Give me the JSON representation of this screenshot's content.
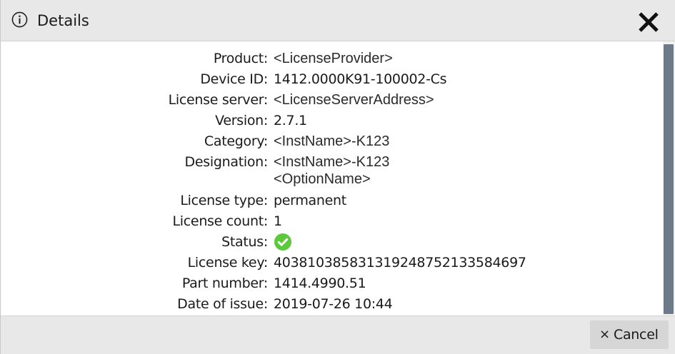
{
  "dialog": {
    "title": "Details",
    "info_icon": "info-circle-icon",
    "close_icon": "close-icon"
  },
  "details": {
    "product": {
      "label": "Product:",
      "value": "<LicenseProvider>"
    },
    "device_id": {
      "label": "Device ID:",
      "value": "1412.0000K91-100002-Cs"
    },
    "license_server": {
      "label": "License server:",
      "value": "<LicenseServerAddress>"
    },
    "version": {
      "label": "Version:",
      "value": "2.7.1"
    },
    "category": {
      "label": "Category:",
      "value": "<InstName>-K123"
    },
    "designation": {
      "label": "Designation:",
      "value_line1": "<InstName>-K123",
      "value_line2": "<OptionName>"
    },
    "license_type": {
      "label": "License type:",
      "value": "permanent"
    },
    "license_count": {
      "label": "License count:",
      "value": "1"
    },
    "status": {
      "label": "Status:",
      "icon": "check-circle-icon",
      "color": "#5cc93a"
    },
    "license_key": {
      "label": "License key:",
      "value": "403810385831319248752133584697"
    },
    "part_number": {
      "label": "Part number:",
      "value": "1414.4990.51"
    },
    "date_of_issue": {
      "label": "Date of issue:",
      "value": "2019-07-26 10:44"
    }
  },
  "footer": {
    "cancel_icon": "close-small-icon",
    "cancel_symbol": "×",
    "cancel_label": "Cancel"
  },
  "colors": {
    "titlebar": "#e8e8e8",
    "scrollbar_thumb": "#6c7a89",
    "status_ok": "#5cc93a",
    "text": "#1a1a1a"
  }
}
